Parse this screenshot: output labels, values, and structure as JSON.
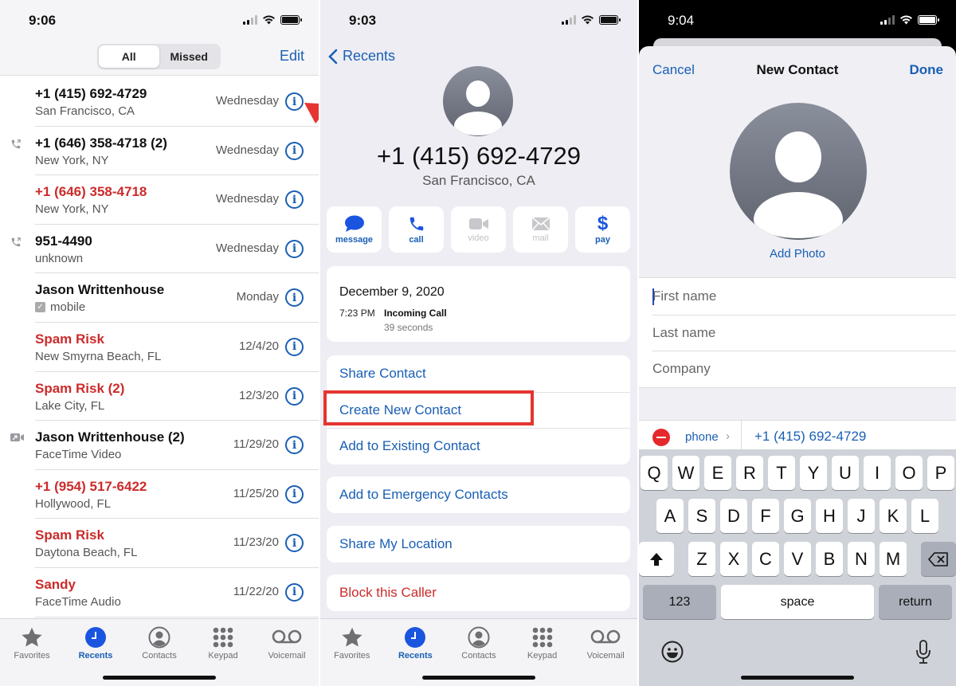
{
  "colors": {
    "accent": "#1a5fb4",
    "danger": "#cc2b2b",
    "annotation": "#e53431",
    "active_tab": "#1a55e0"
  },
  "panel1": {
    "status": {
      "time": "9:06"
    },
    "segments": [
      {
        "label": "All",
        "active": true
      },
      {
        "label": "Missed",
        "active": false
      }
    ],
    "edit_label": "Edit",
    "recents": [
      {
        "name": "+1 (415) 692-4729",
        "subtitle": "San Francisco, CA",
        "date": "Wednesday",
        "missed": false,
        "type_icon": ""
      },
      {
        "name": "+1 (646) 358-4718 (2)",
        "subtitle": "New York, NY",
        "date": "Wednesday",
        "missed": false,
        "type_icon": "outgoing-call-icon"
      },
      {
        "name": "+1 (646) 358-4718",
        "subtitle": "New York, NY",
        "date": "Wednesday",
        "missed": true,
        "type_icon": ""
      },
      {
        "name": "951-4490",
        "subtitle": "unknown",
        "date": "Wednesday",
        "missed": false,
        "type_icon": "outgoing-call-icon"
      },
      {
        "name": "Jason Writtenhouse",
        "subtitle": "mobile",
        "date": "Monday",
        "missed": false,
        "type_icon": "",
        "sub_icon": "checkbox-icon"
      },
      {
        "name": "Spam Risk",
        "subtitle": "New Smyrna Beach, FL",
        "date": "12/4/20",
        "missed": true,
        "type_icon": ""
      },
      {
        "name": "Spam Risk (2)",
        "subtitle": "Lake City, FL",
        "date": "12/3/20",
        "missed": true,
        "type_icon": ""
      },
      {
        "name": "Jason Writtenhouse (2)",
        "subtitle": "FaceTime Video",
        "date": "11/29/20",
        "missed": false,
        "type_icon": "outgoing-video-icon"
      },
      {
        "name": "+1 (954) 517-6422",
        "subtitle": "Hollywood, FL",
        "date": "11/25/20",
        "missed": true,
        "type_icon": ""
      },
      {
        "name": "Spam Risk",
        "subtitle": "Daytona Beach, FL",
        "date": "11/23/20",
        "missed": true,
        "type_icon": ""
      },
      {
        "name": "Sandy",
        "subtitle": "FaceTime Audio",
        "date": "11/22/20",
        "missed": true,
        "type_icon": ""
      }
    ]
  },
  "tabbar": {
    "items": [
      {
        "label": "Favorites",
        "icon": "star-icon",
        "active": false
      },
      {
        "label": "Recents",
        "icon": "clock-icon",
        "active": true
      },
      {
        "label": "Contacts",
        "icon": "person-circle-icon",
        "active": false
      },
      {
        "label": "Keypad",
        "icon": "keypad-icon",
        "active": false
      },
      {
        "label": "Voicemail",
        "icon": "voicemail-icon",
        "active": false
      }
    ]
  },
  "panel2": {
    "status": {
      "time": "9:03"
    },
    "back_label": "Recents",
    "number": "+1 (415) 692-4729",
    "location": "San Francisco, CA",
    "actions": [
      {
        "label": "message",
        "icon": "message-icon",
        "enabled": true
      },
      {
        "label": "call",
        "icon": "phone-icon",
        "enabled": true
      },
      {
        "label": "video",
        "icon": "video-icon",
        "enabled": false
      },
      {
        "label": "mail",
        "icon": "mail-icon",
        "enabled": false
      },
      {
        "label": "pay",
        "icon": "dollar-icon",
        "enabled": true
      }
    ],
    "call_log": {
      "date": "December 9, 2020",
      "time": "7:23 PM",
      "type": "Incoming Call",
      "duration": "39 seconds"
    },
    "menu_group_1": [
      "Share Contact",
      "Create New Contact",
      "Add to Existing Contact"
    ],
    "menu_group_2": [
      "Add to Emergency Contacts"
    ],
    "menu_group_3": [
      "Share My Location"
    ],
    "menu_group_4": [
      "Block this Caller"
    ],
    "highlighted_item": "Create New Contact"
  },
  "panel3": {
    "status": {
      "time": "9:04"
    },
    "cancel_label": "Cancel",
    "title": "New Contact",
    "done_label": "Done",
    "add_photo_label": "Add Photo",
    "fields": [
      {
        "placeholder": "First name",
        "value": "",
        "focused": true
      },
      {
        "placeholder": "Last name",
        "value": ""
      },
      {
        "placeholder": "Company",
        "value": ""
      }
    ],
    "phone": {
      "label": "phone",
      "value": "+1 (415) 692-4729"
    },
    "keyboard": {
      "row1": [
        "Q",
        "W",
        "E",
        "R",
        "T",
        "Y",
        "U",
        "I",
        "O",
        "P"
      ],
      "row2": [
        "A",
        "S",
        "D",
        "F",
        "G",
        "H",
        "J",
        "K",
        "L"
      ],
      "row3": [
        "Z",
        "X",
        "C",
        "V",
        "B",
        "N",
        "M"
      ],
      "numbers_label": "123",
      "space_label": "space",
      "return_label": "return"
    }
  }
}
